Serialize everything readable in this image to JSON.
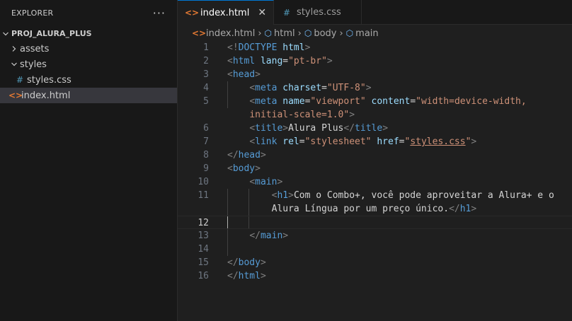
{
  "explorer": {
    "title": "EXPLORER",
    "more": "···",
    "project": "PROJ_ALURA_PLUS",
    "items": [
      {
        "label": "assets"
      },
      {
        "label": "styles"
      },
      {
        "label": "styles.css",
        "icon": "#"
      },
      {
        "label": "index.html",
        "icon": "<>"
      }
    ]
  },
  "tabs": [
    {
      "label": "index.html",
      "icon": "<>",
      "close": "✕"
    },
    {
      "label": "styles.css",
      "icon": "#"
    }
  ],
  "breadcrumb": [
    "index.html",
    "html",
    "body",
    "main"
  ],
  "editor": {
    "line_numbers": [
      "1",
      "2",
      "3",
      "4",
      "5",
      "",
      "6",
      "7",
      "8",
      "9",
      "10",
      "11",
      "",
      "12",
      "13",
      "14",
      "15",
      "16"
    ],
    "lines": [
      [
        [
          "t-br",
          "<!"
        ],
        [
          "t-tag",
          "DOCTYPE"
        ],
        [
          "t-txt",
          " "
        ],
        [
          "t-attr",
          "html"
        ],
        [
          "t-br",
          ">"
        ]
      ],
      [
        [
          "t-br",
          "<"
        ],
        [
          "t-tag",
          "html"
        ],
        [
          "t-txt",
          " "
        ],
        [
          "t-attr",
          "lang"
        ],
        [
          "t-txt",
          "="
        ],
        [
          "t-str",
          "\"pt-br\""
        ],
        [
          "t-br",
          ">"
        ]
      ],
      [
        [
          "t-br",
          "<"
        ],
        [
          "t-tag",
          "head"
        ],
        [
          "t-br",
          ">"
        ]
      ],
      [
        [
          "t-txt",
          "    "
        ],
        [
          "t-br",
          "<"
        ],
        [
          "t-tag",
          "meta"
        ],
        [
          "t-txt",
          " "
        ],
        [
          "t-attr",
          "charset"
        ],
        [
          "t-txt",
          "="
        ],
        [
          "t-str",
          "\"UTF-8\""
        ],
        [
          "t-br",
          ">"
        ]
      ],
      [
        [
          "t-txt",
          "    "
        ],
        [
          "t-br",
          "<"
        ],
        [
          "t-tag",
          "meta"
        ],
        [
          "t-txt",
          " "
        ],
        [
          "t-attr",
          "name"
        ],
        [
          "t-txt",
          "="
        ],
        [
          "t-str",
          "\"viewport\""
        ],
        [
          "t-txt",
          " "
        ],
        [
          "t-attr",
          "content"
        ],
        [
          "t-txt",
          "="
        ],
        [
          "t-str",
          "\"width=device-width,"
        ]
      ],
      [
        [
          "t-txt",
          "    "
        ],
        [
          "t-str",
          "initial-scale=1.0\""
        ],
        [
          "t-br",
          ">"
        ]
      ],
      [
        [
          "t-txt",
          "    "
        ],
        [
          "t-br",
          "<"
        ],
        [
          "t-tag",
          "title"
        ],
        [
          "t-br",
          ">"
        ],
        [
          "t-txt",
          "Alura Plus"
        ],
        [
          "t-br",
          "</"
        ],
        [
          "t-tag",
          "title"
        ],
        [
          "t-br",
          ">"
        ]
      ],
      [
        [
          "t-txt",
          "    "
        ],
        [
          "t-br",
          "<"
        ],
        [
          "t-tag",
          "link"
        ],
        [
          "t-txt",
          " "
        ],
        [
          "t-attr",
          "rel"
        ],
        [
          "t-txt",
          "="
        ],
        [
          "t-str",
          "\"stylesheet\""
        ],
        [
          "t-txt",
          " "
        ],
        [
          "t-attr",
          "href"
        ],
        [
          "t-txt",
          "="
        ],
        [
          "t-str",
          "\""
        ],
        [
          "t-str ul",
          "styles.css"
        ],
        [
          "t-str",
          "\""
        ],
        [
          "t-br",
          ">"
        ]
      ],
      [
        [
          "t-br",
          "</"
        ],
        [
          "t-tag",
          "head"
        ],
        [
          "t-br",
          ">"
        ]
      ],
      [
        [
          "t-br",
          "<"
        ],
        [
          "t-tag",
          "body"
        ],
        [
          "t-br",
          ">"
        ]
      ],
      [
        [
          "t-txt",
          "    "
        ],
        [
          "t-br",
          "<"
        ],
        [
          "t-tag",
          "main"
        ],
        [
          "t-br",
          ">"
        ]
      ],
      [
        [
          "t-txt",
          "        "
        ],
        [
          "t-br",
          "<"
        ],
        [
          "t-tag",
          "h1"
        ],
        [
          "t-br",
          ">"
        ],
        [
          "t-txt",
          "Com o Combo+, você pode aproveitar a Alura+ e o"
        ]
      ],
      [
        [
          "t-txt",
          "        Alura Língua por um preço único."
        ],
        [
          "t-br",
          "</"
        ],
        [
          "t-tag",
          "h1"
        ],
        [
          "t-br",
          ">"
        ]
      ],
      [
        [
          "t-txt",
          ""
        ]
      ],
      [
        [
          "t-txt",
          "    "
        ],
        [
          "t-br",
          "</"
        ],
        [
          "t-tag",
          "main"
        ],
        [
          "t-br",
          ">"
        ]
      ],
      [
        [
          "t-txt",
          ""
        ]
      ],
      [
        [
          "t-br",
          "</"
        ],
        [
          "t-tag",
          "body"
        ],
        [
          "t-br",
          ">"
        ]
      ],
      [
        [
          "t-br",
          "</"
        ],
        [
          "t-tag",
          "html"
        ],
        [
          "t-br",
          ">"
        ]
      ]
    ]
  }
}
